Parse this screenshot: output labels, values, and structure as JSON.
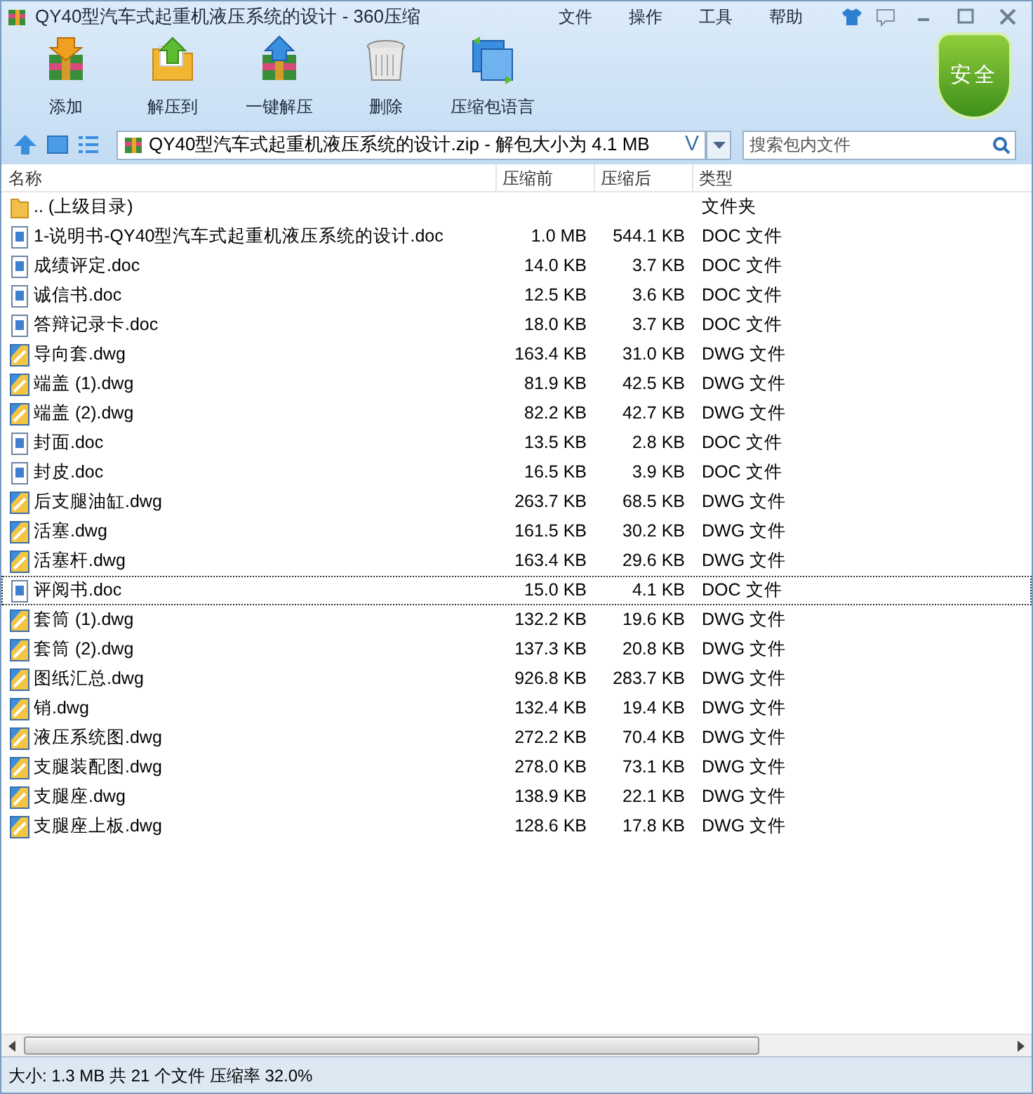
{
  "window": {
    "title": "QY40型汽车式起重机液压系统的设计 - 360压缩"
  },
  "menu": [
    "文件",
    "操作",
    "工具",
    "帮助"
  ],
  "toolbar": [
    {
      "label": "添加",
      "kind": "add"
    },
    {
      "label": "解压到",
      "kind": "extract"
    },
    {
      "label": "一键解压",
      "kind": "quick"
    },
    {
      "label": "删除",
      "kind": "delete"
    },
    {
      "label": "压缩包语言",
      "kind": "language"
    }
  ],
  "security_badge": "安全",
  "address": {
    "value": "QY40型汽车式起重机液压系统的设计.zip - 解包大小为 4.1 MB",
    "letter": "V"
  },
  "search": {
    "placeholder": "搜索包内文件"
  },
  "table": {
    "columns": [
      "名称",
      "压缩前",
      "压缩后",
      "类型"
    ],
    "rows": [
      {
        "kind": "folder",
        "name": ".. (上级目录)",
        "size": "",
        "packed": "",
        "type": "文件夹",
        "selected": false
      },
      {
        "kind": "doc",
        "name": "1-说明书-QY40型汽车式起重机液压系统的设计.doc",
        "size": "1.0 MB",
        "packed": "544.1 KB",
        "type": "DOC 文件",
        "selected": false
      },
      {
        "kind": "doc",
        "name": "成绩评定.doc",
        "size": "14.0 KB",
        "packed": "3.7 KB",
        "type": "DOC 文件",
        "selected": false
      },
      {
        "kind": "doc",
        "name": "诚信书.doc",
        "size": "12.5 KB",
        "packed": "3.6 KB",
        "type": "DOC 文件",
        "selected": false
      },
      {
        "kind": "doc",
        "name": "答辩记录卡.doc",
        "size": "18.0 KB",
        "packed": "3.7 KB",
        "type": "DOC 文件",
        "selected": false
      },
      {
        "kind": "dwg",
        "name": "导向套.dwg",
        "size": "163.4 KB",
        "packed": "31.0 KB",
        "type": "DWG 文件",
        "selected": false
      },
      {
        "kind": "dwg",
        "name": "端盖 (1).dwg",
        "size": "81.9 KB",
        "packed": "42.5 KB",
        "type": "DWG 文件",
        "selected": false
      },
      {
        "kind": "dwg",
        "name": "端盖 (2).dwg",
        "size": "82.2 KB",
        "packed": "42.7 KB",
        "type": "DWG 文件",
        "selected": false
      },
      {
        "kind": "doc",
        "name": "封面.doc",
        "size": "13.5 KB",
        "packed": "2.8 KB",
        "type": "DOC 文件",
        "selected": false
      },
      {
        "kind": "doc",
        "name": "封皮.doc",
        "size": "16.5 KB",
        "packed": "3.9 KB",
        "type": "DOC 文件",
        "selected": false
      },
      {
        "kind": "dwg",
        "name": "后支腿油缸.dwg",
        "size": "263.7 KB",
        "packed": "68.5 KB",
        "type": "DWG 文件",
        "selected": false
      },
      {
        "kind": "dwg",
        "name": "活塞.dwg",
        "size": "161.5 KB",
        "packed": "30.2 KB",
        "type": "DWG 文件",
        "selected": false
      },
      {
        "kind": "dwg",
        "name": "活塞杆.dwg",
        "size": "163.4 KB",
        "packed": "29.6 KB",
        "type": "DWG 文件",
        "selected": false
      },
      {
        "kind": "doc",
        "name": "评阅书.doc",
        "size": "15.0 KB",
        "packed": "4.1 KB",
        "type": "DOC 文件",
        "selected": true
      },
      {
        "kind": "dwg",
        "name": "套筒 (1).dwg",
        "size": "132.2 KB",
        "packed": "19.6 KB",
        "type": "DWG 文件",
        "selected": false
      },
      {
        "kind": "dwg",
        "name": "套筒 (2).dwg",
        "size": "137.3 KB",
        "packed": "20.8 KB",
        "type": "DWG 文件",
        "selected": false
      },
      {
        "kind": "dwg",
        "name": "图纸汇总.dwg",
        "size": "926.8 KB",
        "packed": "283.7 KB",
        "type": "DWG 文件",
        "selected": false
      },
      {
        "kind": "dwg",
        "name": "销.dwg",
        "size": "132.4 KB",
        "packed": "19.4 KB",
        "type": "DWG 文件",
        "selected": false
      },
      {
        "kind": "dwg",
        "name": "液压系统图.dwg",
        "size": "272.2 KB",
        "packed": "70.4 KB",
        "type": "DWG 文件",
        "selected": false
      },
      {
        "kind": "dwg",
        "name": "支腿装配图.dwg",
        "size": "278.0 KB",
        "packed": "73.1 KB",
        "type": "DWG 文件",
        "selected": false
      },
      {
        "kind": "dwg",
        "name": "支腿座.dwg",
        "size": "138.9 KB",
        "packed": "22.1 KB",
        "type": "DWG 文件",
        "selected": false
      },
      {
        "kind": "dwg",
        "name": "支腿座上板.dwg",
        "size": "128.6 KB",
        "packed": "17.8 KB",
        "type": "DWG 文件",
        "selected": false
      }
    ]
  },
  "status_bar": "大小: 1.3 MB 共 21 个文件 压缩率 32.0%"
}
